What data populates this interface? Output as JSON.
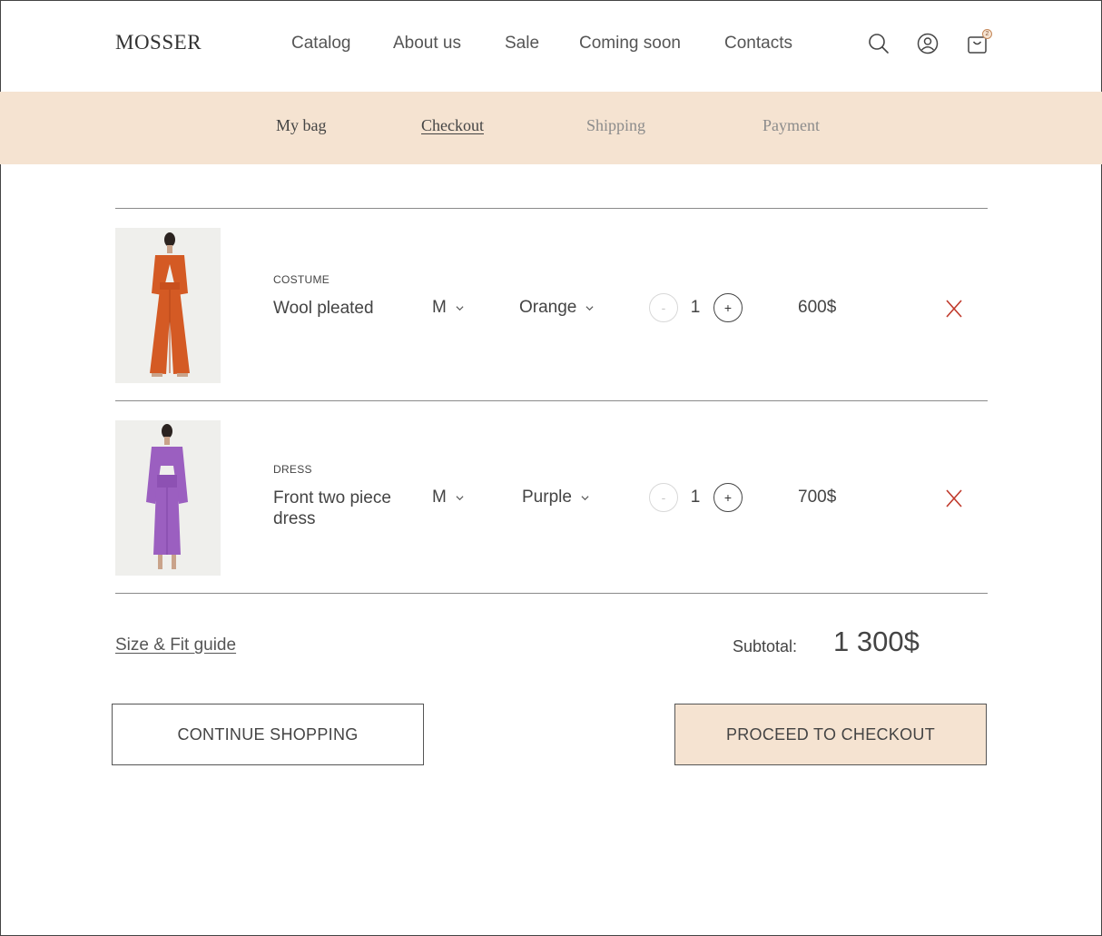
{
  "header": {
    "logo": "MOSSER",
    "nav": [
      "Catalog",
      "About us",
      "Sale",
      "Coming soon",
      "Contacts"
    ],
    "icons": [
      "search-icon",
      "account-icon",
      "cart-icon"
    ],
    "cart_count": "2"
  },
  "steps": {
    "my_bag": "My bag",
    "checkout": "Checkout",
    "shipping": "Shipping",
    "payment": "Payment"
  },
  "items": [
    {
      "category": "COSTUME",
      "name": "Wool pleated",
      "size": "M",
      "color": "Orange",
      "quantity": "1",
      "minus": "-",
      "plus": "+",
      "price": "600$"
    },
    {
      "category": "DRESS",
      "name": "Front two piece dress",
      "size": "M",
      "color": "Purple",
      "quantity": "1",
      "minus": "-",
      "plus": "+",
      "price": "700$"
    }
  ],
  "summary": {
    "size_guide": "Size & Fit guide",
    "subtotal_label": "Subtotal:",
    "subtotal_value": "1 300$"
  },
  "buttons": {
    "continue": "CONTINUE SHOPPING",
    "checkout": "PROCEED TO CHECKOUT"
  },
  "colors": {
    "accent_bg": "#f5e3d1",
    "remove": "#c0392b",
    "item1_garment": "#d45a24",
    "item2_garment": "#9b5fc0"
  }
}
